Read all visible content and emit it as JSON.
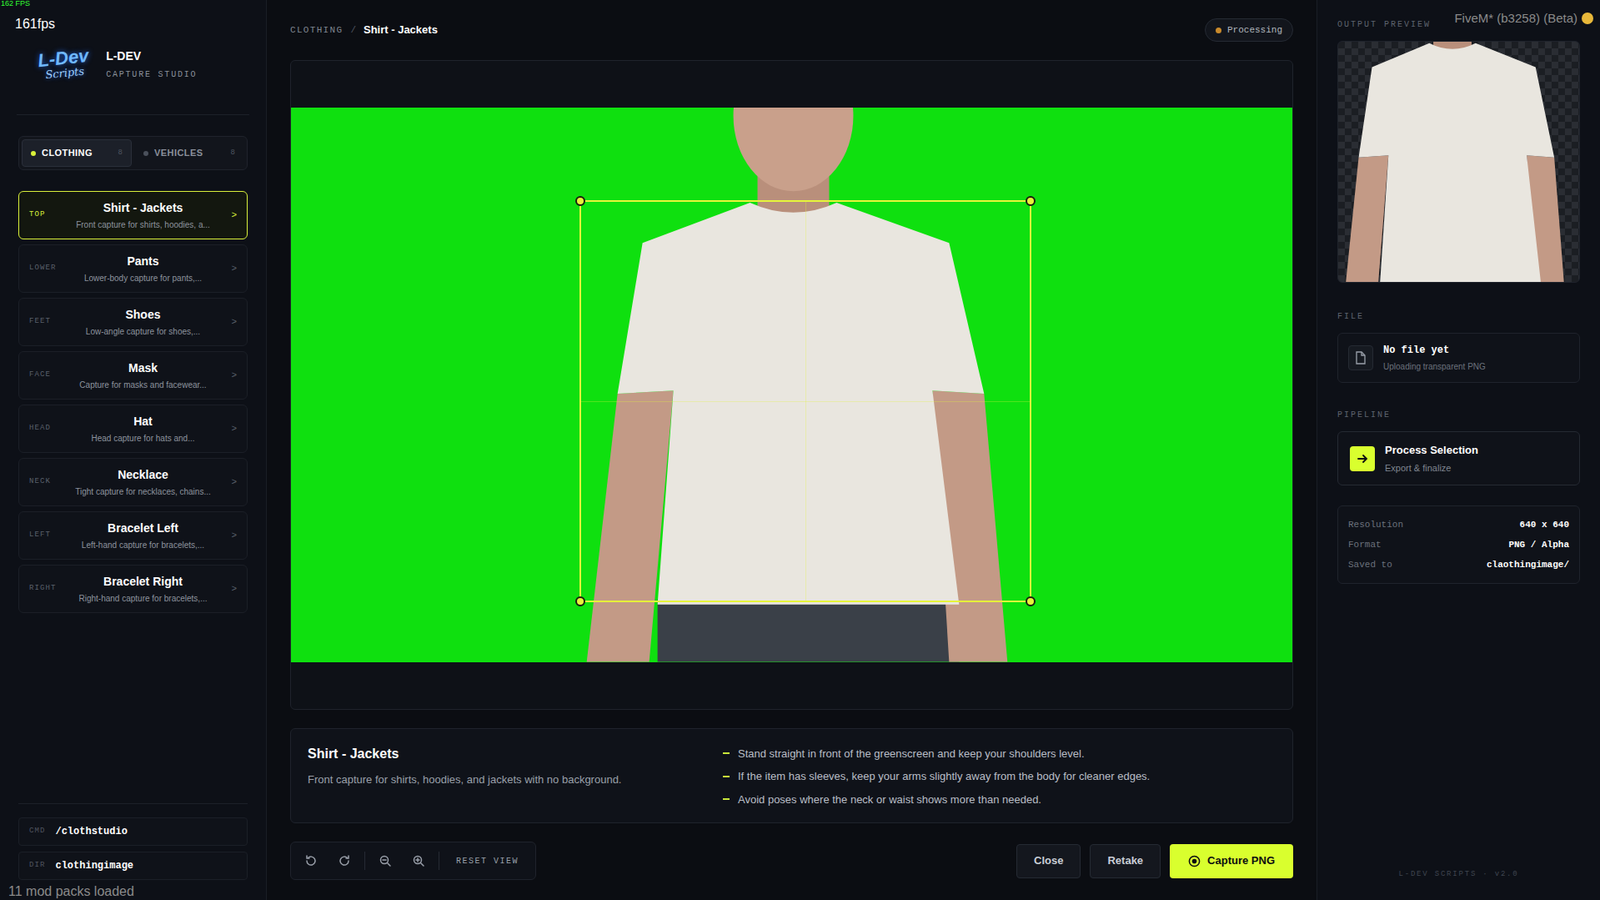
{
  "overlay": {
    "fps_small": "162 FPS",
    "fps": "161fps",
    "build": "FiveM* (b3258) (Beta)",
    "status": "11 mod packs loaded"
  },
  "brand": {
    "logo_top": "L-Dev",
    "logo_bottom": "Scripts",
    "name": "L-DEV",
    "subtitle": "CAPTURE STUDIO"
  },
  "mode_tabs": [
    {
      "label": "CLOTHING",
      "count": "8",
      "selected": true
    },
    {
      "label": "VEHICLES",
      "count": "8",
      "selected": false
    }
  ],
  "categories": [
    {
      "tag": "TOP",
      "title": "Shirt - Jackets",
      "desc": "Front capture for shirts, hoodies, a...",
      "chevron": ">",
      "selected": true
    },
    {
      "tag": "LOWER",
      "title": "Pants",
      "desc": "Lower-body capture for pants,...",
      "chevron": ">",
      "selected": false
    },
    {
      "tag": "FEET",
      "title": "Shoes",
      "desc": "Low-angle capture for shoes,...",
      "chevron": ">",
      "selected": false
    },
    {
      "tag": "FACE",
      "title": "Mask",
      "desc": "Capture for masks and facewear...",
      "chevron": ">",
      "selected": false
    },
    {
      "tag": "HEAD",
      "title": "Hat",
      "desc": "Head capture for hats and...",
      "chevron": ">",
      "selected": false
    },
    {
      "tag": "NECK",
      "title": "Necklace",
      "desc": "Tight capture for necklaces, chains...",
      "chevron": ">",
      "selected": false
    },
    {
      "tag": "LEFT",
      "title": "Bracelet Left",
      "desc": "Left-hand capture for bracelets,...",
      "chevron": ">",
      "selected": false
    },
    {
      "tag": "RIGHT",
      "title": "Bracelet Right",
      "desc": "Right-hand capture for bracelets,...",
      "chevron": ">",
      "selected": false
    }
  ],
  "sidebar_footer": [
    {
      "key": "CMD",
      "value": "/clothstudio"
    },
    {
      "key": "DIR",
      "value": "clothingimage"
    }
  ],
  "breadcrumb": {
    "section": "CLOTHING",
    "separator": "/",
    "current": "Shirt - Jackets"
  },
  "status_badge": {
    "label": "Processing"
  },
  "info": {
    "title": "Shirt - Jackets",
    "desc": "Front capture for shirts, hoodies, and jackets with no background.",
    "tips": [
      "Stand straight in front of the greenscreen and keep your shoulders level.",
      "If the item has sleeves, keep your arms slightly away from the body for cleaner edges.",
      "Avoid poses where the neck or waist shows more than needed."
    ]
  },
  "toolbar": {
    "reset": "RESET VIEW"
  },
  "actions": [
    {
      "label": "Close",
      "kind": "secondary"
    },
    {
      "label": "Retake",
      "kind": "secondary"
    },
    {
      "label": "Capture PNG",
      "kind": "primary"
    }
  ],
  "right": {
    "preview_label": "OUTPUT PREVIEW",
    "file_label": "FILE",
    "file": {
      "title": "No file yet",
      "subtitle": "Uploading transparent PNG"
    },
    "pipeline_label": "PIPELINE",
    "pipeline": {
      "title": "Process Selection",
      "subtitle": "Export & finalize"
    },
    "specs": [
      {
        "label": "Resolution",
        "value": "640 x 640"
      },
      {
        "label": "Format",
        "value": "PNG / Alpha"
      },
      {
        "label": "Saved to",
        "value": "claothingimage/"
      }
    ],
    "footer": "L-DEV SCRIPTS · v2.0"
  }
}
